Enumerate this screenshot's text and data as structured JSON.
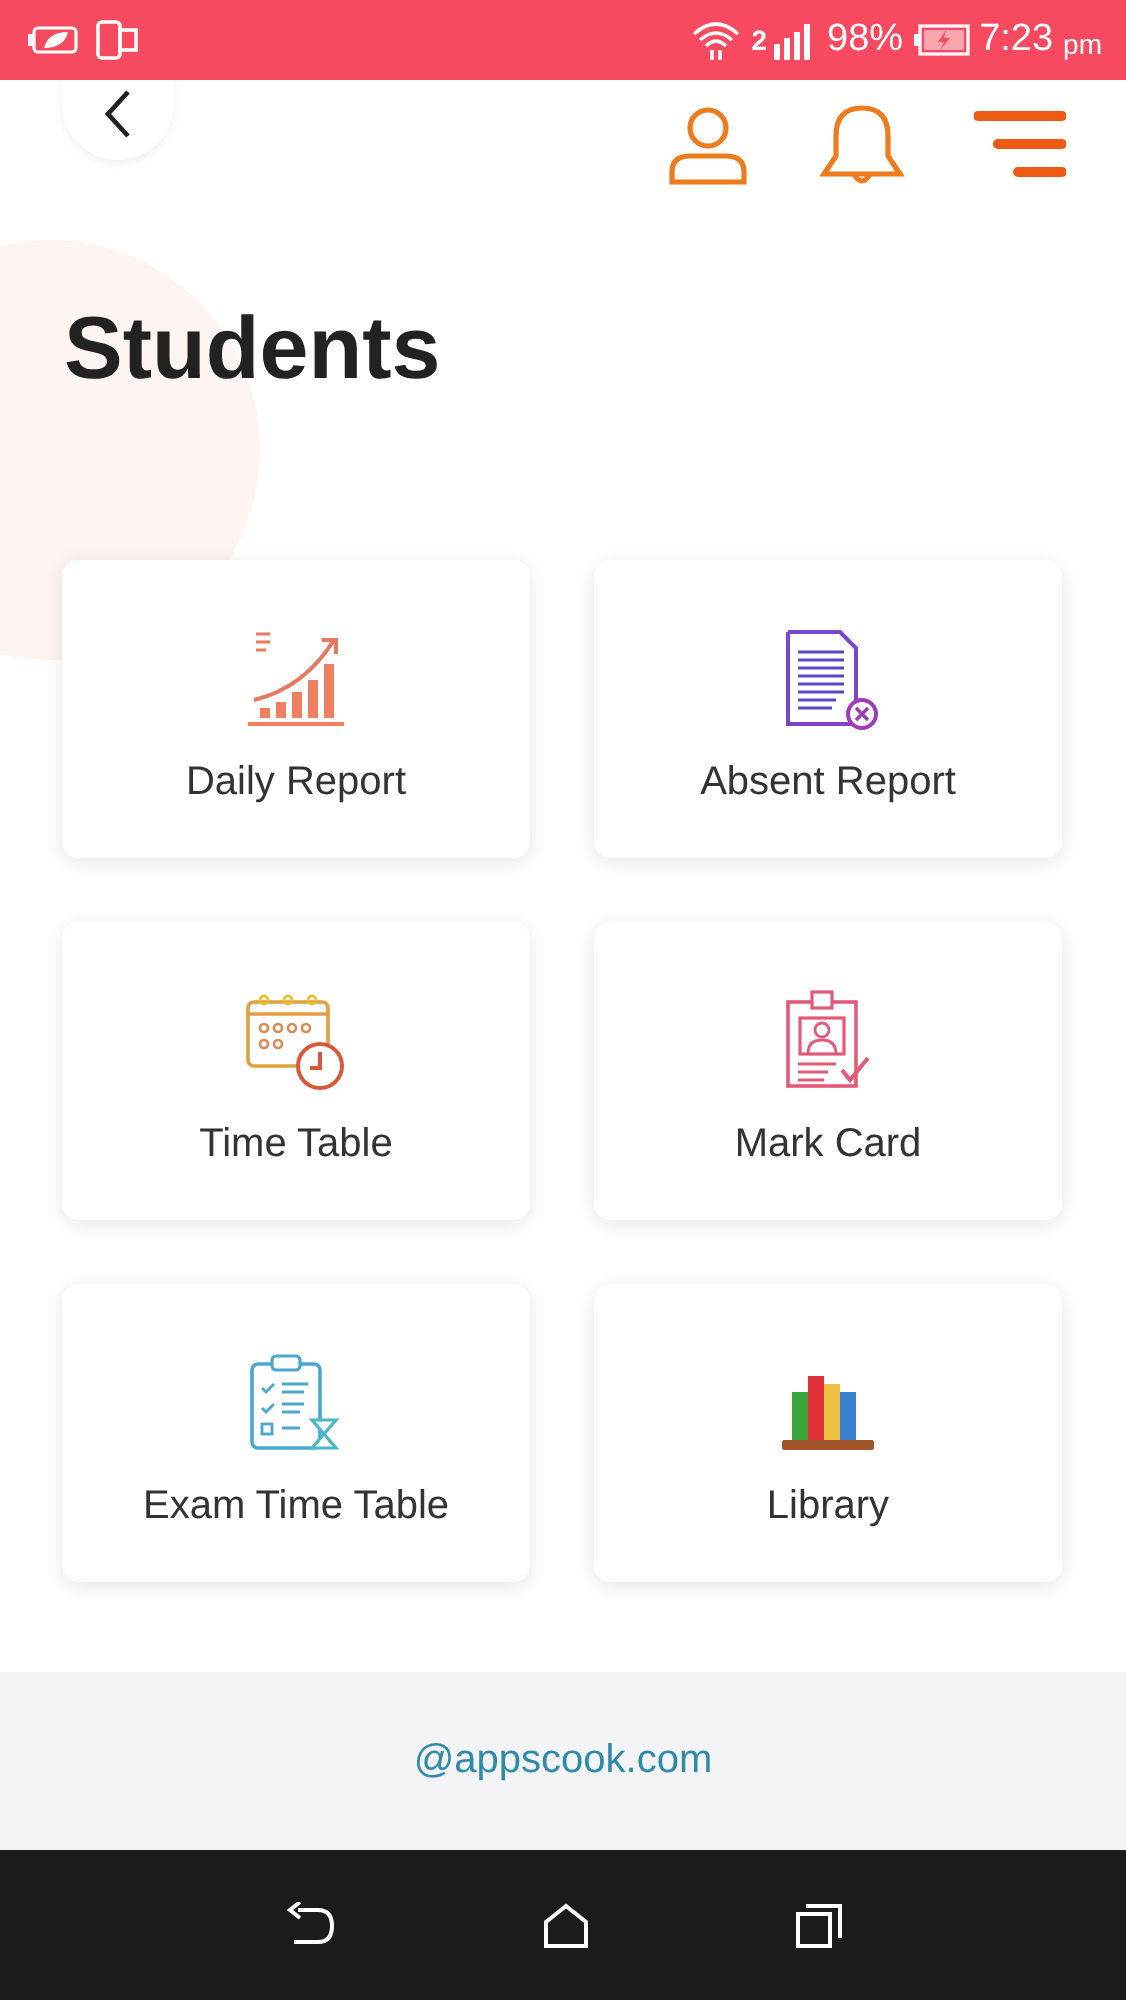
{
  "status_bar": {
    "network_label": "2",
    "battery": "98%",
    "time": "7:23",
    "period": "pm"
  },
  "title": "Students",
  "tiles": [
    {
      "kind": "chart",
      "label": "Daily Report"
    },
    {
      "kind": "document",
      "label": "Absent Report"
    },
    {
      "kind": "calendar",
      "label": "Time Table"
    },
    {
      "kind": "idcard",
      "label": "Mark Card"
    },
    {
      "kind": "clipboard",
      "label": "Exam Time Table"
    },
    {
      "kind": "books",
      "label": "Library"
    }
  ],
  "footer": {
    "link": "@appscook.com"
  }
}
